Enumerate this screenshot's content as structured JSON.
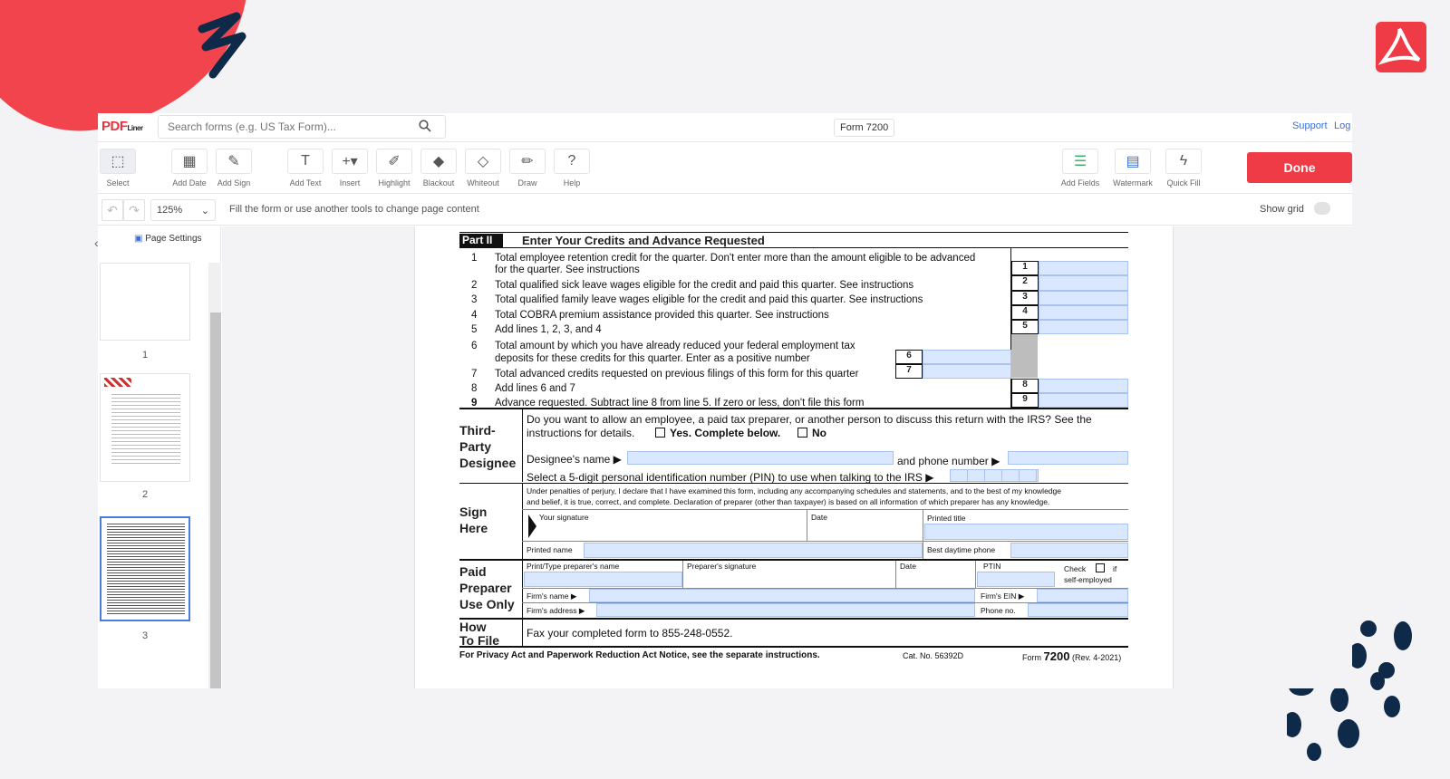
{
  "app": {
    "brand": "PDF",
    "brand_suffix": "Liner",
    "search_placeholder": "Search forms (e.g. US Tax Form)...",
    "doc_title": "Form 7200",
    "support": "Support",
    "log": "Log"
  },
  "toolbar": {
    "tools_left": [
      "Select",
      "Add Date",
      "Add Sign",
      "Add Text",
      "Insert",
      "Highlight",
      "Blackout",
      "Whiteout",
      "Draw",
      "Help"
    ],
    "tools_right": [
      "Add Fields",
      "Watermark",
      "Quick Fill"
    ],
    "done": "Done"
  },
  "subbar": {
    "zoom": "125%",
    "hint": "Fill the form or use another tools to change page content",
    "grid": "Show grid"
  },
  "sidebar": {
    "page_settings": "Page Settings",
    "pages": [
      "1",
      "2",
      "3"
    ],
    "active_page": "3"
  },
  "form": {
    "partII_tag": "Part II",
    "partII_title": "Enter Your Credits and Advance Requested",
    "lines": [
      {
        "n": "1",
        "text": "Total employee retention credit for the quarter. Don't enter more than the amount eligible to be advanced"
      },
      {
        "n": "",
        "text": "for the quarter. See instructions"
      },
      {
        "n": "2",
        "text": "Total qualified sick leave wages eligible for the credit and paid this quarter. See instructions"
      },
      {
        "n": "3",
        "text": "Total qualified family leave wages eligible for the credit and paid this quarter. See instructions"
      },
      {
        "n": "4",
        "text": "Total COBRA premium assistance provided this quarter. See instructions"
      },
      {
        "n": "5",
        "text": "Add lines 1, 2, 3, and 4"
      },
      {
        "n": "6",
        "text": "Total amount by which you have already reduced your federal employment tax"
      },
      {
        "n": "",
        "text": "deposits for these credits for this quarter. Enter as a positive number"
      },
      {
        "n": "7",
        "text": "Total advanced credits requested on previous filings of this form for this quarter"
      },
      {
        "n": "8",
        "text": "Add lines 6 and 7"
      },
      {
        "n": "9",
        "text": "Advance requested. Subtract line 8 from line 5. If zero or less, don't file this form"
      }
    ],
    "third_party": {
      "heading": [
        "Third-",
        "Party",
        "Designee"
      ],
      "question": "Do you want to allow an employee, a paid tax preparer, or another person to discuss this return with the IRS? See the",
      "question2": "instructions for details.",
      "yes": "Yes. Complete below.",
      "no": "No",
      "designee_name": "Designee's name ▶",
      "phone": "and phone number ▶",
      "pin": "Select a 5-digit personal identification number (PIN) to use when talking to the IRS ▶"
    },
    "sign": {
      "heading": [
        "Sign",
        "Here"
      ],
      "penalty1": "Under penalties of perjury, I declare that I have examined this form, including any accompanying schedules and statements, and to the best of my knowledge",
      "penalty2": "and belief, it is true, correct, and complete. Declaration of preparer (other than taxpayer) is based on all information of which preparer has any knowledge.",
      "your_signature": "Your signature",
      "date": "Date",
      "printed_title": "Printed title",
      "printed_name": "Printed name",
      "phone": "Best daytime phone"
    },
    "preparer": {
      "heading": [
        "Paid",
        "Preparer",
        "Use Only"
      ],
      "name": "Print/Type preparer's name",
      "signature": "Preparer's signature",
      "date": "Date",
      "ptin": "PTIN",
      "check": "Check",
      "if": "if",
      "self_employed": "self-employed",
      "firm_name": "Firm's name ▶",
      "firm_ein": "Firm's EIN ▶",
      "firm_address": "Firm's address ▶",
      "phone": "Phone no."
    },
    "howtofile": {
      "heading": [
        "How",
        "To File"
      ],
      "text": "Fax your completed form to 855-248-0552."
    },
    "footer": {
      "privacy": "For Privacy Act and Paperwork Reduction Act Notice, see the separate instructions.",
      "cat": "Cat. No. 56392D",
      "form": "Form",
      "form_num": "7200",
      "rev": "(Rev. 4-2021)"
    }
  },
  "colors": {
    "accent": "#ee3b45",
    "field": "#d9e7ff",
    "link": "#3a6fd8"
  }
}
